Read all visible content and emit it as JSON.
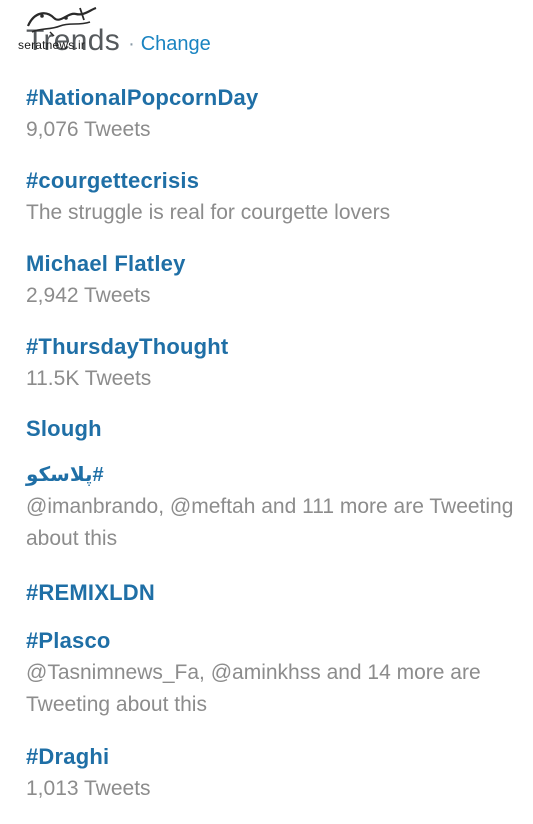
{
  "watermark": {
    "site_text": "seratnews.ir"
  },
  "header": {
    "title": "Trends",
    "separator": "·",
    "change_label": "Change"
  },
  "trends": [
    {
      "name": "#NationalPopcornDay",
      "context": "9,076 Tweets"
    },
    {
      "name": "#courgettecrisis",
      "context": "The struggle is real for courgette lovers"
    },
    {
      "name": "Michael Flatley",
      "context": "2,942 Tweets"
    },
    {
      "name": "#ThursdayThought",
      "context": "11.5K Tweets"
    },
    {
      "name": "Slough",
      "context": ""
    },
    {
      "name": "#پلاسکو",
      "context": "@imanbrando, @meftah and 111 more are Tweeting about this"
    },
    {
      "name": "#REMIXLDN",
      "context": ""
    },
    {
      "name": "#Plasco",
      "context": "@Tasnimnews_Fa, @aminkhss and 14 more are Tweeting about this"
    },
    {
      "name": "#Draghi",
      "context": "1,013 Tweets"
    }
  ]
}
